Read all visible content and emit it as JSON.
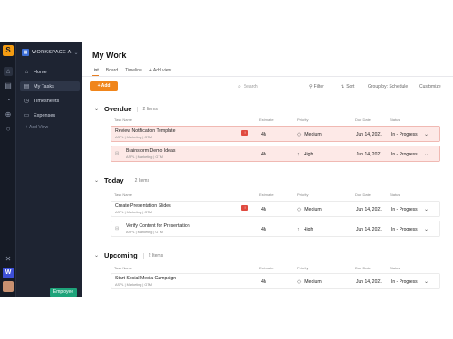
{
  "rail": {
    "logo": "S",
    "workspace_letter": "W",
    "icons": [
      "home-rail-icon",
      "briefcase-rail-icon",
      "bell-rail-icon",
      "plus-circle-rail-icon",
      "search-rail-icon"
    ],
    "bottom_icon": "expand-icon"
  },
  "sidebar": {
    "workspace_name": "WORKSPACE A",
    "items": [
      {
        "label": "Home",
        "icon": "home-icon"
      },
      {
        "label": "My Tasks",
        "icon": "tasks-icon",
        "selected": true
      },
      {
        "label": "Timesheets",
        "icon": "clock-icon"
      },
      {
        "label": "Expenses",
        "icon": "wallet-icon"
      }
    ],
    "add_view": "+ Add View",
    "role_badge": "Employee"
  },
  "main": {
    "title": "My Work",
    "tabs": [
      "List",
      "Board",
      "Timeline",
      "+ Add view"
    ],
    "active_tab": "List",
    "add_button": "+ Add",
    "search_placeholder": "Search",
    "toolbar": {
      "filter": "Filter",
      "sort": "Sort",
      "group": "Group by: Schedule",
      "customize": "Customize"
    }
  },
  "columns": {
    "task": "Task Name",
    "estimate": "Estimate",
    "priority": "Priority",
    "due": "Due Date",
    "status": "Status"
  },
  "sections": [
    {
      "name": "Overdue",
      "count": "2 Items",
      "tasks": [
        {
          "name": "Review Notification Template",
          "sub": "ASPL | Marketing | GTM",
          "flag": "!",
          "estimate": "4h",
          "priority": "Medium",
          "due": "Jun 14, 2021",
          "status": "In - Progress"
        },
        {
          "name": "Brainstorm Demo Ideas",
          "sub": "ASPL | Marketing | GTM",
          "flag": "",
          "estimate": "4h",
          "priority": "High",
          "due": "Jun 14, 2021",
          "status": "In - Progress"
        }
      ]
    },
    {
      "name": "Today",
      "count": "2 Items",
      "tasks": [
        {
          "name": "Create Presentation Slides",
          "sub": "ASPL | Marketing | GTM",
          "flag": "!",
          "estimate": "4h",
          "priority": "Medium",
          "due": "Jun 14, 2021",
          "status": "In - Progress"
        },
        {
          "name": "Verify Content for Presentation",
          "sub": "ASPL | Marketing | GTM",
          "flag": "",
          "estimate": "4h",
          "priority": "High",
          "due": "Jun 14, 2021",
          "status": "In - Progress"
        }
      ]
    },
    {
      "name": "Upcoming",
      "count": "2 Items",
      "tasks": [
        {
          "name": "Start Social Media Campaign",
          "sub": "ASPL | Marketing | GTM",
          "flag": "",
          "estimate": "4h",
          "priority": "Medium",
          "due": "Jun 14, 2021",
          "status": "In - Progress"
        }
      ]
    }
  ],
  "colors": {
    "accent": "#f0851b",
    "overdue_bg": "#fde9e7",
    "sidebar": "#1e2432",
    "rail": "#161b26",
    "employee": "#1ea37a"
  }
}
